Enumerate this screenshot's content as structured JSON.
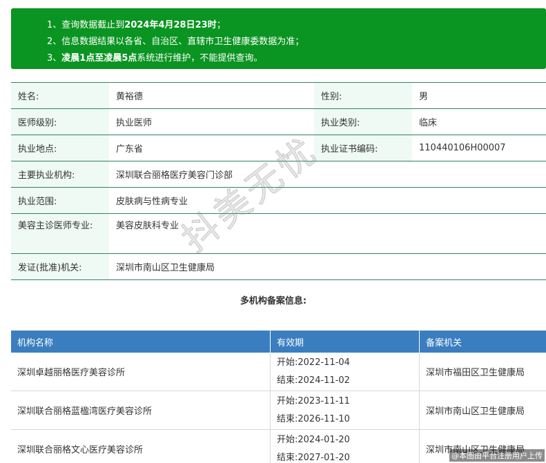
{
  "notice": {
    "line1_pre": "1、查询数据截止到",
    "line1_bold": "2024年4月28日23时",
    "line1_post": "；",
    "line2": "2、信息数据结果以各省、自治区、直辖市卫生健康委数据为准；",
    "line3_pre": "3、",
    "line3_bold": "凌晨1点至凌晨5点",
    "line3_post": "系统进行维护，不能提供查询。"
  },
  "info": {
    "name_label": "姓名:",
    "name_value": "黄裕德",
    "gender_label": "性别:",
    "gender_value": "男",
    "level_label": "医师级别:",
    "level_value": "执业医师",
    "category_label": "执业类别:",
    "category_value": "临床",
    "location_label": "执业地点:",
    "location_value": "广东省",
    "cert_label": "执业证书编码:",
    "cert_value": "110440106H00007",
    "institution_label": "主要执业机构:",
    "institution_value": "深圳联合丽格医疗美容门诊部",
    "scope_label": "执业范围:",
    "scope_value": "皮肤病与性病专业",
    "cosmetic_label": "美容主诊医师专业:",
    "cosmetic_value": "美容皮肤科专业",
    "issuer_label": "发证(批准)机关:",
    "issuer_value": "深圳市南山区卫生健康局"
  },
  "multi_title": "多机构备案信息:",
  "org_table": {
    "headers": [
      "机构名称",
      "有效期",
      "备案机关"
    ],
    "start_prefix": "开始:",
    "end_prefix": "结束:",
    "rows": [
      {
        "name": "深圳卓越丽格医疗美容诊所",
        "start": "2022-11-04",
        "end": "2024-11-02",
        "authority": "深圳市福田区卫生健康局"
      },
      {
        "name": "深圳联合丽格蓝楹湾医疗美容诊所",
        "start": "2023-11-11",
        "end": "2026-11-10",
        "authority": "深圳市南山区卫生健康局"
      },
      {
        "name": "深圳联合丽格文心医疗美容诊所",
        "start": "2024-01-20",
        "end": "2027-01-20",
        "authority": "深圳市南山区卫生健康局"
      }
    ]
  },
  "watermark": "抖美无忧",
  "credit": "@本图由平台注册用户上传",
  "colors": {
    "notice_bg": "#0a9421",
    "label_bg": "#eefaf3",
    "header_bg": "#3a7ebf",
    "border": "#2f7f6f"
  }
}
